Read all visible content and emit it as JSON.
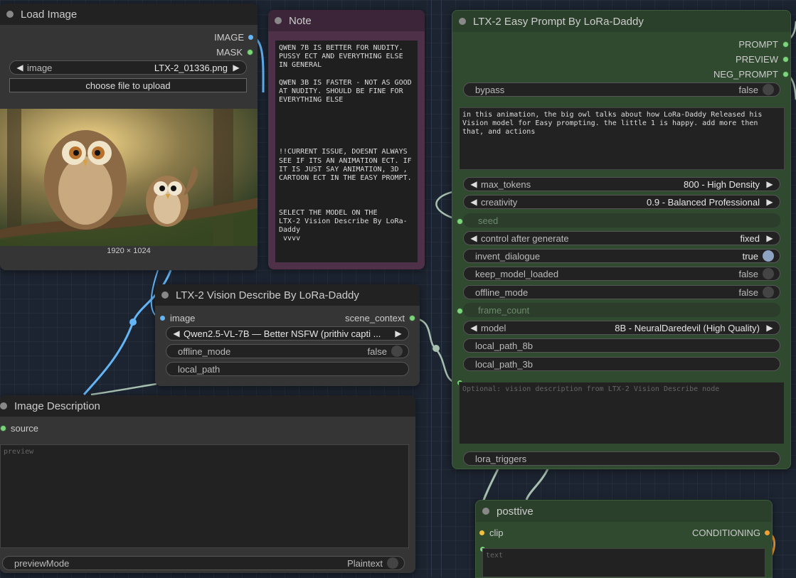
{
  "load_image": {
    "title": "Load Image",
    "outputs": [
      "IMAGE",
      "MASK"
    ],
    "image_widget": {
      "label": "image",
      "value": "LTX-2_01336.png"
    },
    "upload_button": "choose file to upload",
    "dimensions": "1920 × 1024"
  },
  "note": {
    "title": "Note",
    "text": "QWEN 7B IS BETTER FOR NUDITY. PUSSY ECT AND EVERYTHING ELSE IN GENERAL\n\nQWEN 3B IS FASTER - NOT AS GOOD AT NUDITY. SHOULD BE FINE FOR EVERYTHING ELSE\n\n\n\n\n\n!!CURRENT ISSUE, DOESNT ALWAYS SEE IF ITS AN ANIMATION ECT. IF IT IS JUST SAY ANIMATION, 3D , CARTOON ECT IN THE EASY PROMPT.\n\n\n\nSELECT THE MODEL ON THE\nLTX-2 Vision Describe By LoRa-Daddy\n vvvv"
  },
  "vision_describe": {
    "title": "LTX-2 Vision Describe By LoRa-Daddy",
    "input": "image",
    "output": "scene_context",
    "model_value": "Qwen2.5-VL-7B — Better NSFW (prithiv capti ...",
    "offline_mode": {
      "label": "offline_mode",
      "value": "false"
    },
    "local_path": {
      "label": "local_path"
    }
  },
  "image_description": {
    "title": "Image Description",
    "input": "source",
    "preview_placeholder": "preview",
    "preview_mode": {
      "label": "previewMode",
      "value": "Plaintext"
    }
  },
  "easy_prompt": {
    "title": "LTX-2 Easy Prompt By LoRa-Daddy",
    "outputs": [
      "PROMPT",
      "PREVIEW",
      "NEG_PROMPT"
    ],
    "bypass": {
      "label": "bypass",
      "value": "false"
    },
    "prompt_text": "in this animation, the big owl talks about how LoRa-Daddy Released his Vision model for Easy prompting. the little 1 is happy. add more then that, and actions",
    "max_tokens": {
      "label": "max_tokens",
      "value": "800 - High Density"
    },
    "creativity": {
      "label": "creativity",
      "value": "0.9 - Balanced Professional"
    },
    "seed": {
      "label": "seed"
    },
    "control_after_generate": {
      "label": "control after generate",
      "value": "fixed"
    },
    "invent_dialogue": {
      "label": "invent_dialogue",
      "value": "true"
    },
    "keep_model_loaded": {
      "label": "keep_model_loaded",
      "value": "false"
    },
    "offline_mode": {
      "label": "offline_mode",
      "value": "false"
    },
    "frame_count": {
      "label": "frame_count"
    },
    "model": {
      "label": "model",
      "value": "8B - NeuralDaredevil (High Quality)"
    },
    "local_path_8b": {
      "label": "local_path_8b"
    },
    "local_path_3b": {
      "label": "local_path_3b"
    },
    "vision_placeholder": "Optional: vision description from LTX-2 Vision Describe node",
    "lora_triggers": {
      "label": "lora_triggers"
    }
  },
  "positive": {
    "title": "posttive",
    "input": "clip",
    "output": "CONDITIONING",
    "text_placeholder": "text"
  },
  "colors": {
    "canvas": "#1c2431",
    "green_node": "#2f4a2f",
    "note_node": "#4e3149",
    "gray_node": "#353535",
    "image_wire": "#64b5f6",
    "string_wire": "#a8c0b0"
  }
}
